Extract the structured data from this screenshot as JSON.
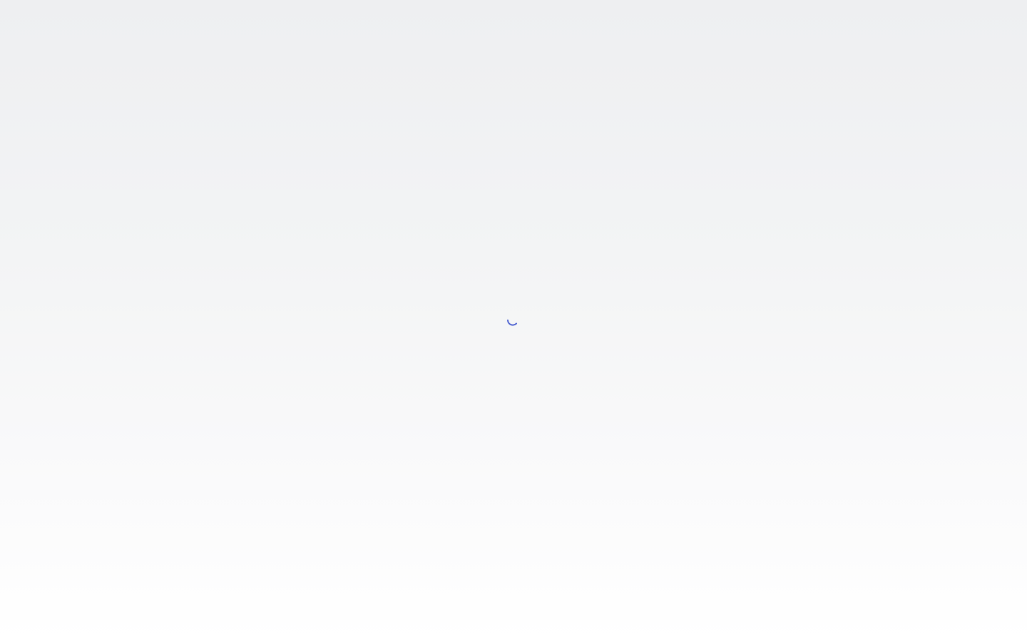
{
  "page": {
    "state": "loading"
  },
  "icons": {
    "spinner": "loading-spinner-icon"
  },
  "colors": {
    "spinner": "#4a5fd0",
    "background_top": "#eeeff1",
    "background_bottom": "#ffffff"
  }
}
